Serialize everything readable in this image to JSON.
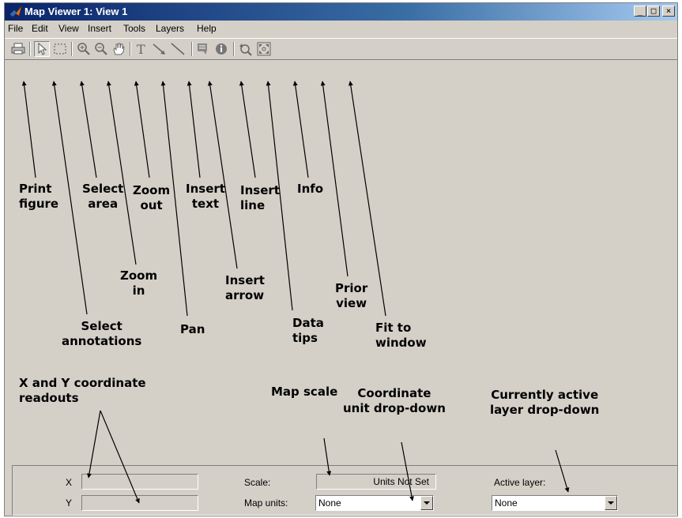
{
  "window": {
    "title": "Map Viewer 1: View 1"
  },
  "title_buttons": [
    {
      "name": "minimize-button",
      "glyph": "_"
    },
    {
      "name": "maximize-button",
      "glyph": "□"
    },
    {
      "name": "close-button",
      "glyph": "×"
    }
  ],
  "menu": [
    "File",
    "Edit",
    "View",
    "Insert",
    "Tools",
    "Layers",
    "Help"
  ],
  "toolbar": [
    {
      "name": "print-icon"
    },
    {
      "name": "select-annotations-icon"
    },
    {
      "name": "select-area-icon"
    },
    {
      "name": "zoom-in-icon"
    },
    {
      "name": "zoom-out-icon"
    },
    {
      "name": "pan-icon"
    },
    {
      "name": "insert-text-icon"
    },
    {
      "name": "insert-arrow-icon"
    },
    {
      "name": "insert-line-icon"
    },
    {
      "name": "data-tips-icon"
    },
    {
      "name": "info-icon"
    },
    {
      "name": "prior-view-icon"
    },
    {
      "name": "fit-to-window-icon"
    }
  ],
  "annotations": {
    "print_figure": [
      "Print",
      "figure"
    ],
    "select_annotations": [
      "Select",
      "annotations"
    ],
    "select_area": [
      "Select",
      "area"
    ],
    "zoom_in": [
      "Zoom",
      "in"
    ],
    "zoom_out": [
      "Zoom",
      "out"
    ],
    "pan": [
      "Pan"
    ],
    "insert_text": [
      "Insert",
      "text"
    ],
    "insert_arrow": [
      "Insert",
      "arrow"
    ],
    "insert_line": [
      "Insert",
      "line"
    ],
    "data_tips": [
      "Data",
      "tips"
    ],
    "info": [
      "Info"
    ],
    "prior_view": [
      "Prior",
      "view"
    ],
    "fit_to_window": [
      "Fit to",
      "window"
    ],
    "xy_readouts": [
      "X and Y coordinate",
      "readouts"
    ],
    "map_scale": [
      "Map scale"
    ],
    "coord_unit": [
      "Coordinate",
      "unit drop-down"
    ],
    "active_layer": [
      "Currently active",
      "layer drop-down"
    ]
  },
  "status": {
    "x_label": "X",
    "y_label": "Y",
    "x_value": "",
    "y_value": "",
    "scale_label": "Scale:",
    "scale_value": "Units Not Set",
    "map_units_label": "Map units:",
    "map_units_value": "None",
    "active_layer_label": "Active layer:",
    "active_layer_value": "None"
  }
}
